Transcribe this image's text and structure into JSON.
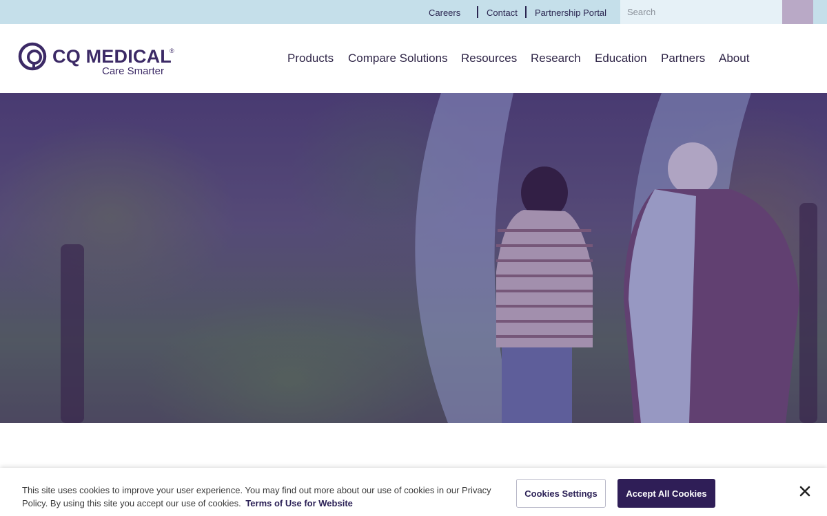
{
  "utility_bar": {
    "links": [
      "Careers",
      "Contact",
      "Partnership Portal"
    ],
    "search": {
      "placeholder": "Search",
      "value": ""
    }
  },
  "logo": {
    "name": "CQ MEDICAL",
    "registered": "®",
    "tagline": "Care Smarter"
  },
  "nav": {
    "items": [
      "Products",
      "Compare Solutions",
      "Resources",
      "Research",
      "Education",
      "Partners",
      "About"
    ]
  },
  "hero": {
    "image": "girl-and-grandparent-walking-in-forest"
  },
  "cookie_banner": {
    "text": "This site uses cookies to improve your user experience. You may find out more about our use of cookies in our Privacy Policy. By using this site you accept our use of cookies.",
    "link_text": "Terms of Use for Website",
    "settings_label": "Cookies Settings",
    "accept_label": "Accept All Cookies",
    "close_icon": "close-icon"
  },
  "colors": {
    "brand": "#3c2a66",
    "accent_button": "#2f1e57",
    "utility_bar": "#c5dfea"
  }
}
